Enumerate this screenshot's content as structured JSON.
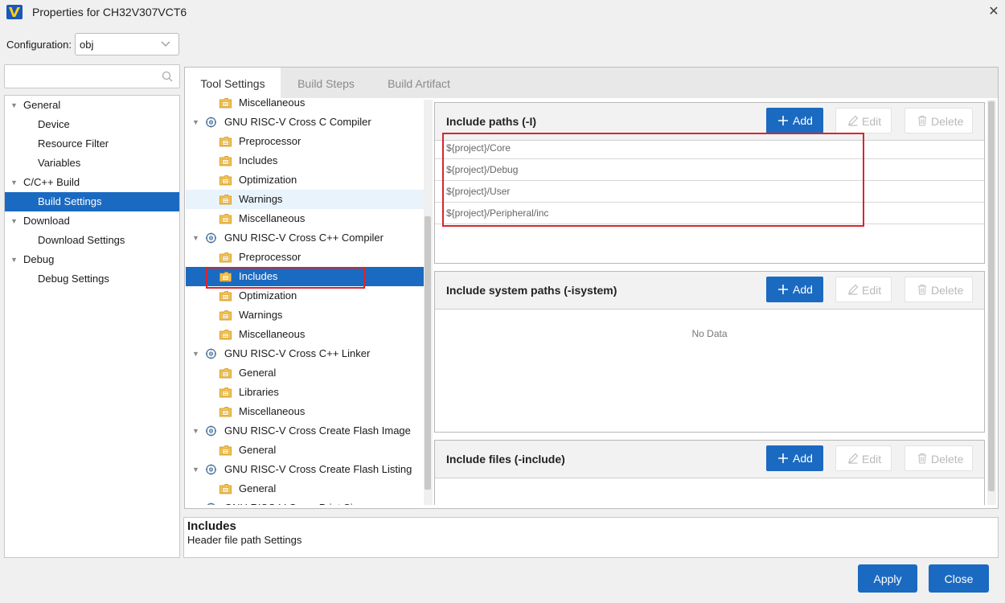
{
  "window": {
    "title": "Properties for CH32V307VCT6",
    "close_glyph": "✕"
  },
  "config": {
    "label": "Configuration:",
    "value": "obj"
  },
  "search": {
    "placeholder": ""
  },
  "left_tree": [
    {
      "label": "General",
      "level": 0,
      "expandable": true,
      "selected": false
    },
    {
      "label": "Device",
      "level": 1,
      "expandable": false,
      "selected": false
    },
    {
      "label": "Resource Filter",
      "level": 1,
      "expandable": false,
      "selected": false
    },
    {
      "label": "Variables",
      "level": 1,
      "expandable": false,
      "selected": false
    },
    {
      "label": "C/C++ Build",
      "level": 0,
      "expandable": true,
      "selected": false
    },
    {
      "label": "Build Settings",
      "level": 1,
      "expandable": false,
      "selected": true
    },
    {
      "label": "Download",
      "level": 0,
      "expandable": true,
      "selected": false
    },
    {
      "label": "Download Settings",
      "level": 1,
      "expandable": false,
      "selected": false
    },
    {
      "label": "Debug",
      "level": 0,
      "expandable": true,
      "selected": false
    },
    {
      "label": "Debug Settings",
      "level": 1,
      "expandable": false,
      "selected": false
    }
  ],
  "tabs": [
    {
      "label": "Tool Settings",
      "active": true
    },
    {
      "label": "Build Steps",
      "active": false
    },
    {
      "label": "Build Artifact",
      "active": false
    }
  ],
  "tool_tree": [
    {
      "label": "Miscellaneous",
      "kind": "option"
    },
    {
      "label": "GNU RISC-V Cross C Compiler",
      "kind": "tool"
    },
    {
      "label": "Preprocessor",
      "kind": "option"
    },
    {
      "label": "Includes",
      "kind": "option"
    },
    {
      "label": "Optimization",
      "kind": "option"
    },
    {
      "label": "Warnings",
      "kind": "option",
      "hover": true
    },
    {
      "label": "Miscellaneous",
      "kind": "option"
    },
    {
      "label": "GNU RISC-V Cross C++ Compiler",
      "kind": "tool"
    },
    {
      "label": "Preprocessor",
      "kind": "option"
    },
    {
      "label": "Includes",
      "kind": "option",
      "selected": true
    },
    {
      "label": "Optimization",
      "kind": "option"
    },
    {
      "label": "Warnings",
      "kind": "option"
    },
    {
      "label": "Miscellaneous",
      "kind": "option"
    },
    {
      "label": "GNU RISC-V Cross C++ Linker",
      "kind": "tool"
    },
    {
      "label": "General",
      "kind": "option"
    },
    {
      "label": "Libraries",
      "kind": "option"
    },
    {
      "label": "Miscellaneous",
      "kind": "option"
    },
    {
      "label": "GNU RISC-V Cross Create Flash Image",
      "kind": "tool"
    },
    {
      "label": "General",
      "kind": "option"
    },
    {
      "label": "GNU RISC-V Cross Create Flash Listing",
      "kind": "tool"
    },
    {
      "label": "General",
      "kind": "option"
    },
    {
      "label": "GNU RISC-V Cross Print Size",
      "kind": "tool"
    }
  ],
  "buttons": {
    "add": "Add",
    "edit": "Edit",
    "delete": "Delete"
  },
  "sections": [
    {
      "title": "Include paths (-I)",
      "rows": [
        "${project}/Core",
        "${project}/Debug",
        "${project}/User",
        "${project}/Peripheral/inc"
      ]
    },
    {
      "title": "Include system paths (-isystem)",
      "empty_text": "No Data"
    },
    {
      "title": "Include files (-include)"
    }
  ],
  "description": {
    "title": "Includes",
    "text": "Header file path Settings"
  },
  "footer": {
    "apply": "Apply",
    "close": "Close"
  },
  "colors": {
    "accent": "#1b6ac1",
    "highlight": "#d9252f",
    "folder": "#f0a500"
  }
}
